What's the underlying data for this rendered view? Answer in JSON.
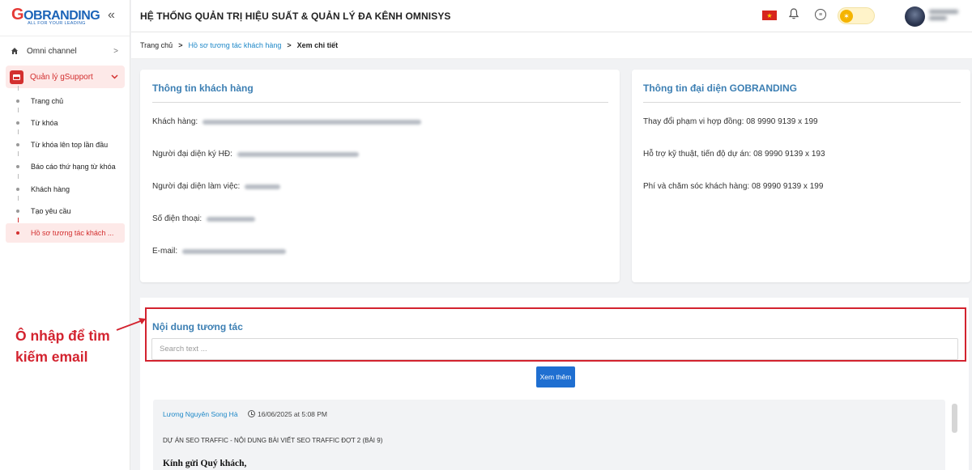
{
  "logo": {
    "main_g": "G",
    "main_rest": "OBRANDING",
    "tagline": "ALL FOR YOUR LEADING"
  },
  "header": {
    "title": "HỆ THỐNG QUẢN TRỊ HIỆU SUẤT & QUẢN LÝ ĐA KÊNH OMNISYS"
  },
  "sidebar": {
    "collapse": "«",
    "items": [
      {
        "label": "Omni channel",
        "icon": "home-icon"
      },
      {
        "label": "Quản lý gSupport",
        "icon": "folder-icon"
      }
    ],
    "sub_items": [
      {
        "label": "Trang chủ"
      },
      {
        "label": "Từ khóa"
      },
      {
        "label": "Từ khóa lên top lần đầu"
      },
      {
        "label": "Báo cáo thứ hạng từ khóa"
      },
      {
        "label": "Khách hàng"
      },
      {
        "label": "Tạo yêu cầu"
      },
      {
        "label": "Hồ sơ tương tác khách ..."
      }
    ]
  },
  "breadcrumb": {
    "home": "Trang chủ",
    "parent": "Hồ sơ tương tác khách hàng",
    "current": "Xem chi tiết"
  },
  "customer": {
    "title": "Thông tin khách hàng",
    "fields": [
      {
        "label": "Khách hàng:"
      },
      {
        "label": "Người đại diện ký HĐ:"
      },
      {
        "label": "Người đại diện làm việc:"
      },
      {
        "label": "Số điện thoại:"
      },
      {
        "label": "E-mail:"
      }
    ]
  },
  "representative": {
    "title": "Thông tin đại diện GOBRANDING",
    "lines": [
      "Thay đổi phạm vi hợp đồng: 08 9990 9139 x 199",
      "Hỗ trợ kỹ thuật, tiến độ dự án: 08 9990 9139 x 193",
      "Phí và chăm sóc khách hàng: 08 9990 9139 x 199"
    ]
  },
  "interaction": {
    "title": "Nội dung tương tác",
    "search_placeholder": "Search text ...",
    "more_button": "Xem thêm",
    "message": {
      "author": "Lương Nguyên Song Hà",
      "time": "16/06/2025 at 5:08 PM",
      "subject": "DỰ ÁN SEO TRAFFIC - NỘI DUNG BÀI VIẾT SEO TRAFFIC ĐỢT 2 (BÀI 9)",
      "greeting": "Kính gửi Quý khách,"
    }
  },
  "annotation": {
    "text": "Ô nhập để tìm kiếm email"
  },
  "colors": {
    "accent_red": "#d3232f",
    "title_blue": "#3c7fb3",
    "link_blue": "#1e88c8",
    "button_blue": "#1f6fd1"
  }
}
